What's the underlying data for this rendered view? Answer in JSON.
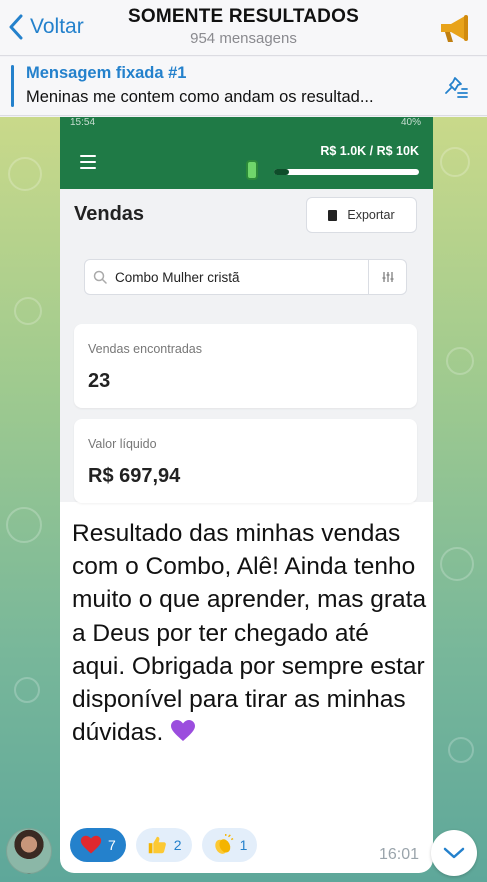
{
  "header": {
    "back_label": "Voltar",
    "title": "SOMENTE RESULTADOS",
    "subtitle": "954 mensagens",
    "channel_icon": "megaphone-icon"
  },
  "pinned": {
    "title": "Mensagem fixada #1",
    "text": "Meninas me contem como andam os resultad..."
  },
  "screenshot": {
    "status_time": "15:54",
    "status_right": "40%",
    "goal_label": "R$ 1.0K / R$ 10K",
    "goal_progress": 0.1,
    "page_title": "Vendas",
    "export_label": "Exportar",
    "search_value": "Combo Mulher cristã",
    "cards": [
      {
        "label": "Vendas encontradas",
        "value": "23"
      },
      {
        "label": "Valor líquido",
        "value": "R$ 697,94"
      }
    ]
  },
  "message": {
    "text": "Resultado das minhas vendas com o Combo, Alê! Ainda tenho muito o que aprender, mas grata a Deus por ter chegado até aqui. Obrigada por sempre estar disponível para tirar as minhas dúvidas.",
    "time": "16:01",
    "reactions": [
      {
        "emoji": "heart-icon",
        "count": "7"
      },
      {
        "emoji": "thumbs-up-icon",
        "count": "2"
      },
      {
        "emoji": "clapping-hands-icon",
        "count": "1"
      }
    ]
  },
  "colors": {
    "accent": "#2481cc",
    "app_green": "#1f7a46"
  }
}
